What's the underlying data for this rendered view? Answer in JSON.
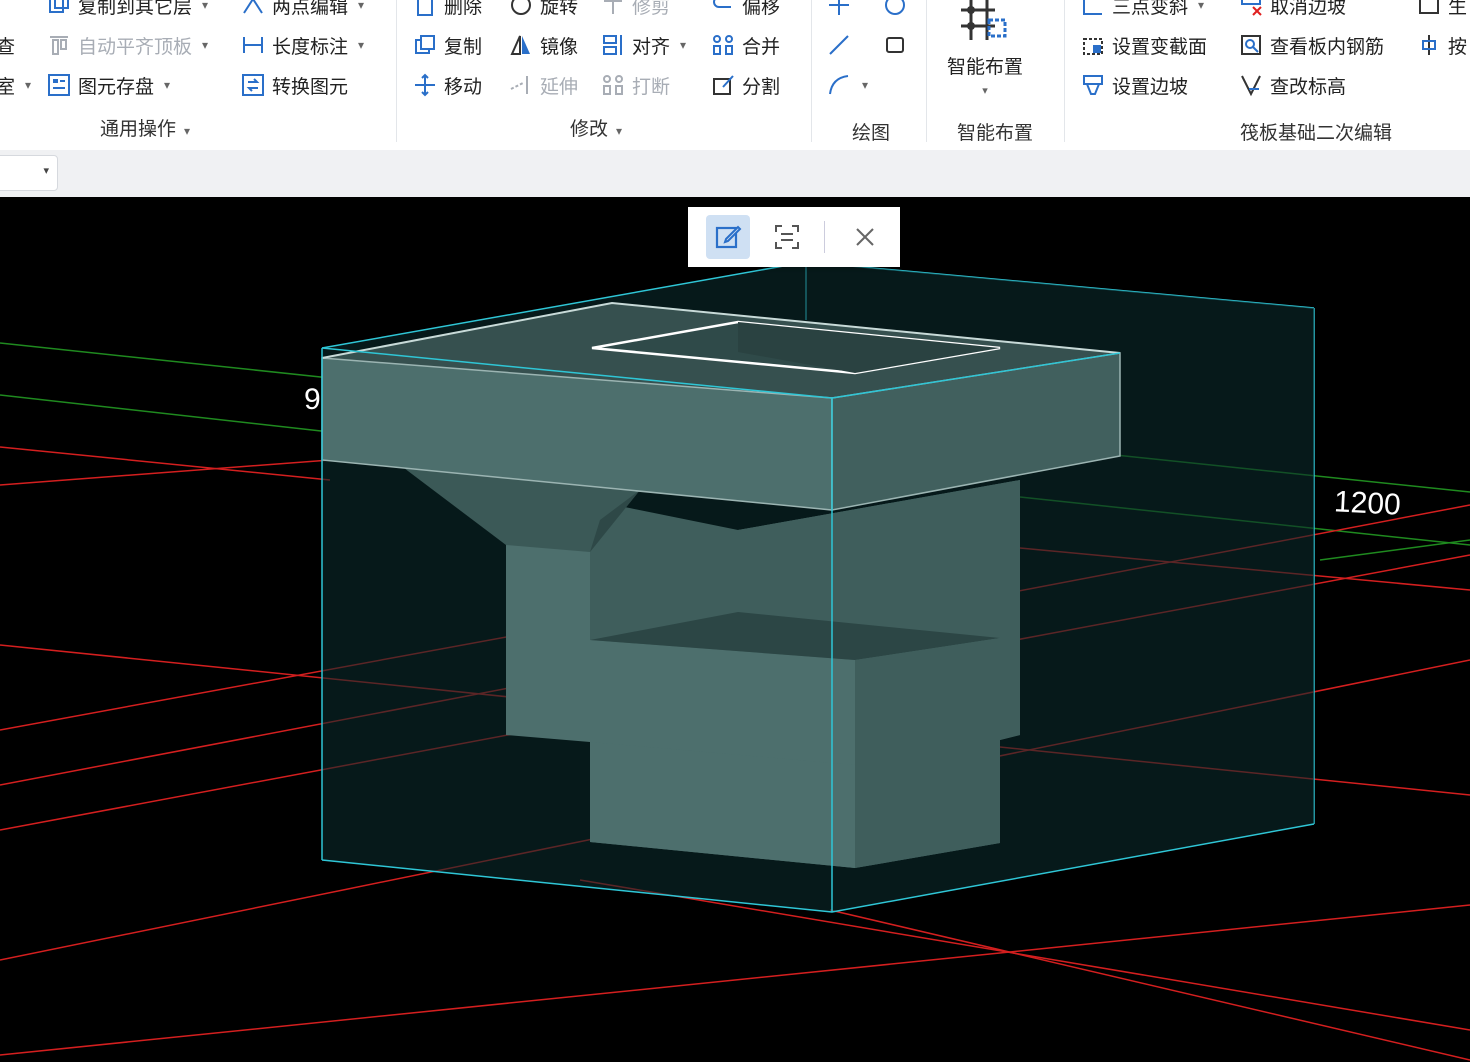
{
  "ribbon": {
    "left_partial": [
      "查",
      "室"
    ],
    "general": {
      "items": [
        {
          "id": "copy-to-layer",
          "label": "复制到其它层",
          "dropdown": true,
          "enabled": true
        },
        {
          "id": "auto-align-top",
          "label": "自动平齐顶板",
          "dropdown": true,
          "enabled": false
        },
        {
          "id": "save-element",
          "label": "图元存盘",
          "dropdown": true,
          "enabled": true
        },
        {
          "id": "two-point-edit",
          "label": "两点编辑",
          "dropdown": true,
          "enabled": true
        },
        {
          "id": "length-dim",
          "label": "长度标注",
          "dropdown": true,
          "enabled": true
        },
        {
          "id": "convert-element",
          "label": "转换图元",
          "dropdown": false,
          "enabled": true
        }
      ],
      "label": "通用操作"
    },
    "modify": {
      "items": [
        {
          "id": "delete",
          "label": "删除",
          "enabled": true
        },
        {
          "id": "copy",
          "label": "复制",
          "enabled": true
        },
        {
          "id": "move",
          "label": "移动",
          "enabled": true
        },
        {
          "id": "rotate",
          "label": "旋转",
          "enabled": true
        },
        {
          "id": "mirror",
          "label": "镜像",
          "enabled": true
        },
        {
          "id": "extend",
          "label": "延伸",
          "enabled": false
        },
        {
          "id": "trim",
          "label": "修剪",
          "enabled": false
        },
        {
          "id": "align",
          "label": "对齐",
          "enabled": true,
          "dropdown": true
        },
        {
          "id": "break",
          "label": "打断",
          "enabled": false
        },
        {
          "id": "offset",
          "label": "偏移",
          "enabled": true
        },
        {
          "id": "merge",
          "label": "合并",
          "enabled": true
        },
        {
          "id": "split",
          "label": "分割",
          "enabled": true
        }
      ],
      "label": "修改"
    },
    "draw": {
      "label": "绘图"
    },
    "smart": {
      "button_label": "智能布置",
      "label": "智能布置"
    },
    "raft": {
      "items": [
        {
          "id": "three-point-slope",
          "label": "三点变斜",
          "dropdown": true
        },
        {
          "id": "set-variable-section",
          "label": "设置变截面"
        },
        {
          "id": "set-edge-slope",
          "label": "设置边坡"
        },
        {
          "id": "cancel-edge-slope",
          "label": "取消边坡"
        },
        {
          "id": "view-slab-rebar",
          "label": "查看板内钢筋"
        },
        {
          "id": "check-elevation",
          "label": "查改标高"
        },
        {
          "id": "gen-partial",
          "label": "生"
        },
        {
          "id": "by-partial",
          "label": "按"
        }
      ],
      "label": "筏板基础二次编辑"
    }
  },
  "toolbar_strip": {
    "combo_value": ""
  },
  "floating_toolbar": {
    "buttons": [
      {
        "id": "edit",
        "icon": "edit-icon",
        "active": true
      },
      {
        "id": "scan",
        "icon": "scan-icon",
        "active": false
      },
      {
        "id": "close",
        "icon": "close-icon",
        "active": false
      }
    ]
  },
  "viewport": {
    "dimension_labels": {
      "left": "9",
      "right": "1200"
    },
    "colors": {
      "background": "#000000",
      "grid_red": "#d41f1f",
      "grid_green": "#1f8a1f",
      "bbox_cyan": "#2fc6d6",
      "solid_face": "#4d6f6d",
      "solid_top": "#3c5a58",
      "outline_white": "#ffffff"
    }
  }
}
